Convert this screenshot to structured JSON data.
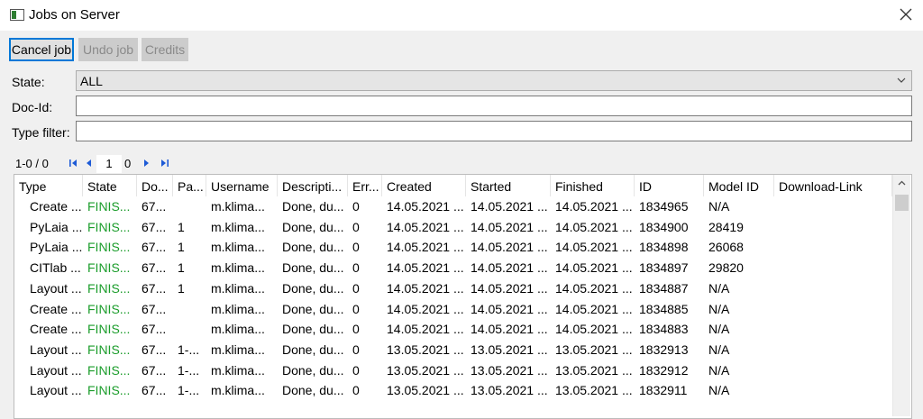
{
  "window": {
    "title": "Jobs on Server",
    "icon": "window-app-icon",
    "close_icon": "close-icon"
  },
  "toolbar": {
    "cancel_label": "Cancel job",
    "undo_label": "Undo job",
    "credits_label": "Credits"
  },
  "filters": {
    "state_label": "State:",
    "state_value": "ALL",
    "docid_label": "Doc-Id:",
    "docid_value": "",
    "type_label": "Type filter:",
    "type_value": ""
  },
  "pager": {
    "range": "1-0 / 0",
    "page": "1",
    "total": "0"
  },
  "table": {
    "columns": [
      "Type",
      "State",
      "Do...",
      "Pa...",
      "Username",
      "Descripti...",
      "Err...",
      "Created",
      "Started",
      "Finished",
      "ID",
      "Model ID",
      "Download-Link"
    ],
    "rows": [
      [
        "Create ...",
        "FINIS...",
        "67...",
        "",
        "m.klima...",
        "Done, du...",
        "0",
        "14.05.2021 ...",
        "14.05.2021 ...",
        "14.05.2021 ...",
        "1834965",
        "N/A",
        ""
      ],
      [
        "PyLaia ...",
        "FINIS...",
        "67...",
        "1",
        "m.klima...",
        "Done, du...",
        "0",
        "14.05.2021 ...",
        "14.05.2021 ...",
        "14.05.2021 ...",
        "1834900",
        "28419",
        ""
      ],
      [
        "PyLaia ...",
        "FINIS...",
        "67...",
        "1",
        "m.klima...",
        "Done, du...",
        "0",
        "14.05.2021 ...",
        "14.05.2021 ...",
        "14.05.2021 ...",
        "1834898",
        "26068",
        ""
      ],
      [
        "CITlab ...",
        "FINIS...",
        "67...",
        "1",
        "m.klima...",
        "Done, du...",
        "0",
        "14.05.2021 ...",
        "14.05.2021 ...",
        "14.05.2021 ...",
        "1834897",
        "29820",
        ""
      ],
      [
        "Layout ...",
        "FINIS...",
        "67...",
        "1",
        "m.klima...",
        "Done, du...",
        "0",
        "14.05.2021 ...",
        "14.05.2021 ...",
        "14.05.2021 ...",
        "1834887",
        "N/A",
        ""
      ],
      [
        "Create ...",
        "FINIS...",
        "67...",
        "",
        "m.klima...",
        "Done, du...",
        "0",
        "14.05.2021 ...",
        "14.05.2021 ...",
        "14.05.2021 ...",
        "1834885",
        "N/A",
        ""
      ],
      [
        "Create ...",
        "FINIS...",
        "67...",
        "",
        "m.klima...",
        "Done, du...",
        "0",
        "14.05.2021 ...",
        "14.05.2021 ...",
        "14.05.2021 ...",
        "1834883",
        "N/A",
        ""
      ],
      [
        "Layout ...",
        "FINIS...",
        "67...",
        "1-...",
        "m.klima...",
        "Done, du...",
        "0",
        "13.05.2021 ...",
        "13.05.2021 ...",
        "13.05.2021 ...",
        "1832913",
        "N/A",
        ""
      ],
      [
        "Layout ...",
        "FINIS...",
        "67...",
        "1-...",
        "m.klima...",
        "Done, du...",
        "0",
        "13.05.2021 ...",
        "13.05.2021 ...",
        "13.05.2021 ...",
        "1832912",
        "N/A",
        ""
      ],
      [
        "Layout ...",
        "FINIS...",
        "67...",
        "1-...",
        "m.klima...",
        "Done, du...",
        "0",
        "13.05.2021 ...",
        "13.05.2021 ...",
        "13.05.2021 ...",
        "1832911",
        "N/A",
        ""
      ]
    ]
  },
  "colors": {
    "finished_state": "#1a9c2a",
    "focus_border": "#0078d7"
  }
}
